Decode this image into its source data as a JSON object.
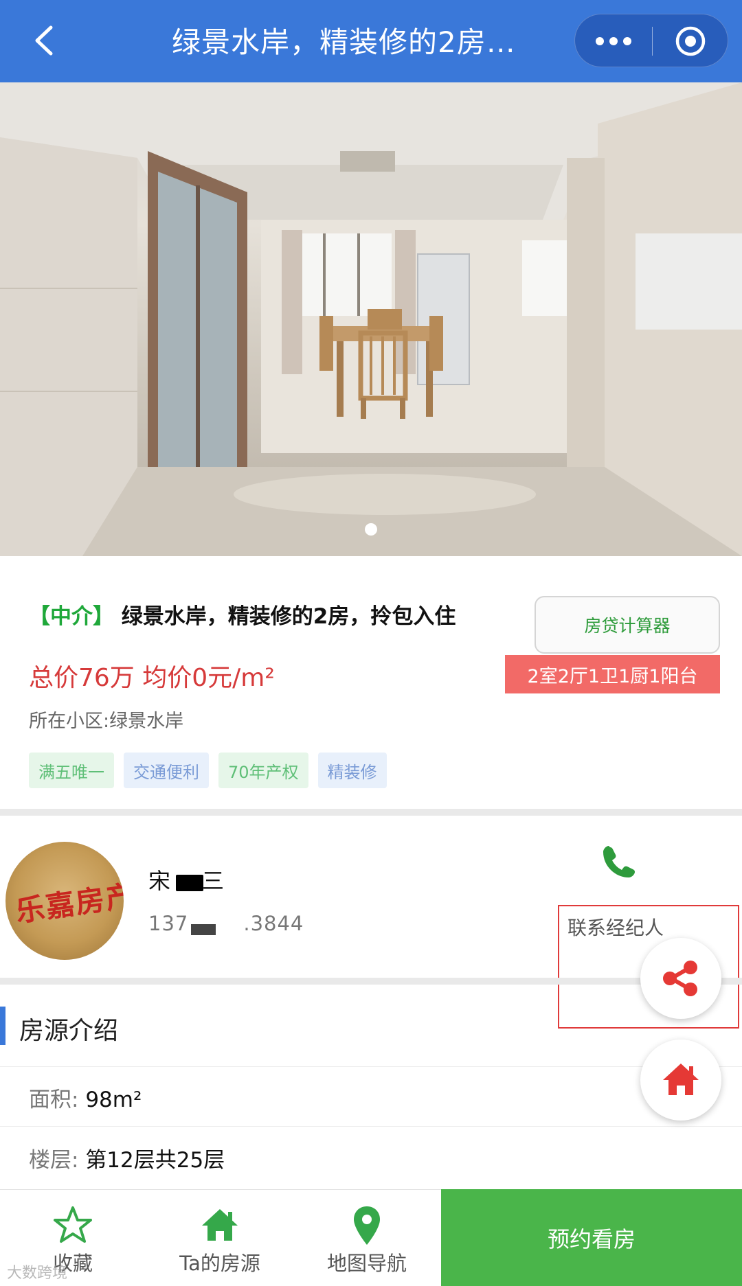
{
  "header": {
    "title": "绿景水岸，精装修的2房…",
    "back_icon": "chevron-left-icon",
    "more_icon": "more-dots-icon",
    "target_icon": "target-circle-icon",
    "bg_color": "#3a78d9"
  },
  "gallery": {
    "description_icon": "room-photo",
    "active_dot": 1,
    "total_dots": 1
  },
  "listing": {
    "tag": "【中介】",
    "title": "绿景水岸，精装修的2房，拎包入住",
    "calculator_label": "房贷计算器",
    "price": "总价76万 均价0元/m²",
    "layout": "2室2厅1卫1厨1阳台",
    "community": "所在小区:绿景水岸",
    "tags": [
      "满五唯一",
      "交通便利",
      "70年产权",
      "精装修"
    ]
  },
  "agent": {
    "avatar_text": "乐嘉房产",
    "name": "宋",
    "name_suffix": "三",
    "phone_prefix": "137",
    "phone_suffix": ".3844",
    "contact_label": "联系经纪人",
    "phone_icon": "phone-icon"
  },
  "details": {
    "section_title": "房源介绍",
    "area_label": "面积:",
    "area_value": "98m²",
    "floor_label": "楼层:",
    "floor_value": "第12层共25层"
  },
  "floating": {
    "share_icon": "share-icon",
    "home_icon": "home-icon",
    "accent": "#e53935"
  },
  "bottom_nav": {
    "favorite": "收藏",
    "listings": "Ta的房源",
    "map": "地图导航",
    "book": "预约看房",
    "accent": "#35a84a"
  },
  "watermark": "大数跨境"
}
